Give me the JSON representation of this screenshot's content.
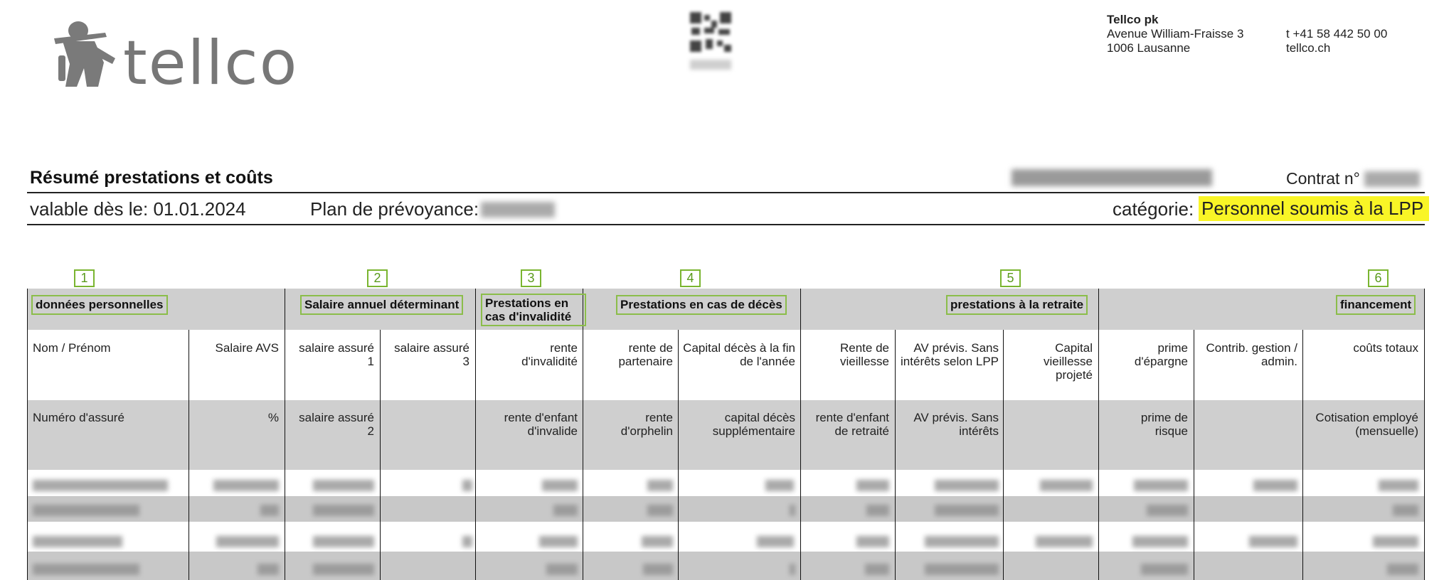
{
  "header": {
    "logo_text": "tellco",
    "company_name": "Tellco pk",
    "address_line1": "Avenue William-Fraisse 3",
    "address_line2": "1006 Lausanne",
    "phone": "t +41 58 442 50 00",
    "website": "tellco.ch"
  },
  "document": {
    "title": "Résumé prestations et coûts",
    "contract_label": "Contrat n°",
    "valid_label": "valable dès le: 01.01.2024",
    "plan_label": "Plan de prévoyance:",
    "category_label": "catégorie:",
    "category_value": "Personnel soumis à la LPP"
  },
  "sections": {
    "s1": {
      "number": "1",
      "label": "données personnelles"
    },
    "s2": {
      "number": "2",
      "label": "Salaire annuel déterminant"
    },
    "s3": {
      "number": "3",
      "label": "Prestations en cas d'invalidité"
    },
    "s4": {
      "number": "4",
      "label": "Prestations en cas de décès"
    },
    "s5": {
      "number": "5",
      "label": "prestations à la retraite"
    },
    "s6": {
      "number": "6",
      "label": "financement"
    }
  },
  "columns": {
    "row1": {
      "c1": "Nom / Prénom",
      "c2": "Salaire AVS",
      "c3": "salaire assuré 1",
      "c4": "salaire assuré 3",
      "c5": "rente d'invalidité",
      "c6": "rente de partenaire",
      "c7": "Capital décès à la fin de l'année",
      "c8": "Rente de vieillesse",
      "c9": "AV prévis. Sans intérêts selon LPP",
      "c10": "Capital vieillesse projeté",
      "c11": "prime d'épargne",
      "c12": "Contrib. gestion / admin.",
      "c13": "coûts totaux"
    },
    "row2": {
      "c1": "Numéro d'assuré",
      "c2": "%",
      "c3": "salaire assuré 2",
      "c5": "rente d'enfant d'invalide",
      "c6": "rente d'orphelin",
      "c7": "capital décès supplémentaire",
      "c8": "rente d'enfant de retraité",
      "c9": "AV prévis. Sans intérêts",
      "c11": "prime de risque",
      "c13": "Cotisation employé (mensuelle)"
    }
  },
  "colors": {
    "section_border": "#8bbd4a",
    "grey_band": "#cfcfcf",
    "highlight": "#f9f526"
  }
}
